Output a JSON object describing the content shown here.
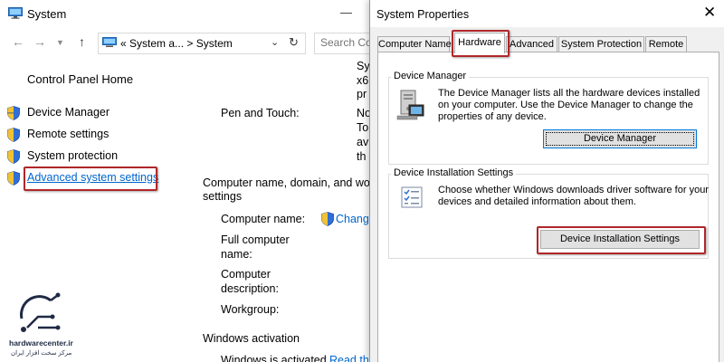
{
  "system_window": {
    "title": "System",
    "address": {
      "crumb_prefix": "«",
      "crumb_1": "System a...",
      "separator": ">",
      "crumb_2": "System"
    },
    "search_placeholder": "Search Co",
    "control_panel_home": "Control Panel Home",
    "tasks": [
      {
        "label": "Device Manager"
      },
      {
        "label": "Remote settings"
      },
      {
        "label": "System protection"
      },
      {
        "label": "Advanced system settings"
      }
    ],
    "clipped_values": [
      "Sy",
      "x6",
      "pr",
      "No",
      "To",
      "av",
      "th"
    ],
    "pen_touch_label": "Pen and Touch:",
    "computer_name_section": {
      "line1": "Computer name, domain, and wor",
      "line2": "settings"
    },
    "computer_name_label": "Computer name:",
    "change_link": "Chang",
    "full_computer_name": {
      "line1": "Full computer",
      "line2": "name:"
    },
    "computer_description": {
      "line1": "Computer",
      "line2": "description:"
    },
    "workgroup_label": "Workgroup:",
    "windows_activation": "Windows activation",
    "activation_status": "Windows is activated",
    "read_link": "Read th"
  },
  "dialog": {
    "title": "System Properties",
    "tabs": [
      {
        "label": "Computer Name"
      },
      {
        "label": "Hardware"
      },
      {
        "label": "Advanced"
      },
      {
        "label": "System Protection"
      },
      {
        "label": "Remote"
      }
    ],
    "device_manager": {
      "group_label": "Device Manager",
      "description_lines": [
        "The Device Manager lists all the hardware devices installed",
        "on your computer. Use the Device Manager to change the",
        "properties of any device."
      ],
      "button_label": "Device Manager"
    },
    "device_installation": {
      "group_label": "Device Installation Settings",
      "description_lines": [
        "Choose whether Windows downloads driver software for your",
        "devices and detailed information about them."
      ],
      "button_label": "Device Installation Settings"
    }
  },
  "watermark": {
    "brand": "hardwarecenter.ir",
    "subtitle": "مرکز سخت افزار ایران"
  },
  "colors": {
    "link": "#0066cc",
    "highlight": "#b0272a",
    "dialog_bg": "#f0f0f0",
    "focus_border": "#0078d7"
  }
}
